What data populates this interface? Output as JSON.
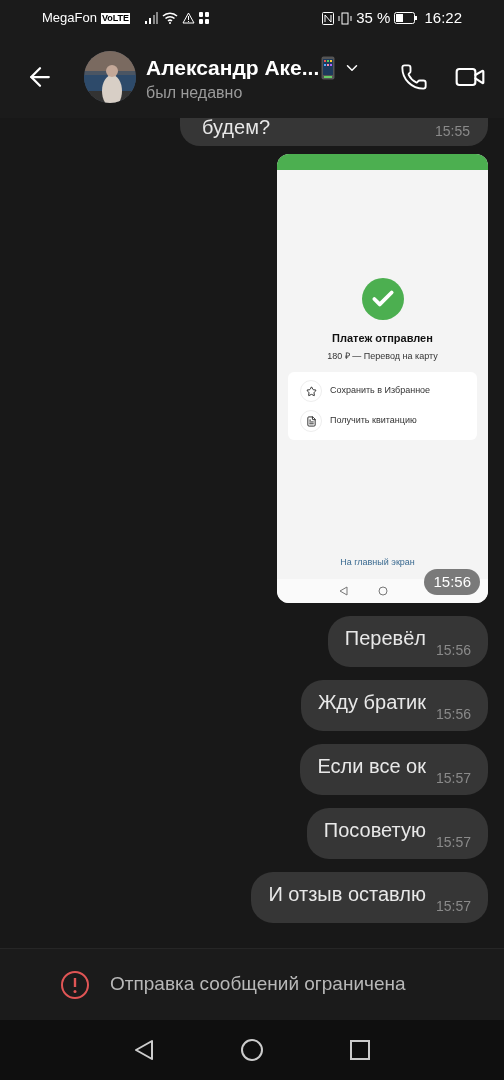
{
  "status_bar": {
    "carrier": "MegaFon",
    "volte": "VoLTE",
    "battery_text": "35 %",
    "time": "16:22"
  },
  "header": {
    "name": "Александр Аке...",
    "status": "был недавно"
  },
  "messages": [
    {
      "kind": "cut_text",
      "text": "будем?",
      "time": "15:55"
    },
    {
      "kind": "image",
      "time": "15:56",
      "screenshot": {
        "title": "Платеж отправлен",
        "subtitle": "180 ₽ — Перевод на карту",
        "actions": [
          "Сохранить в Избранное",
          "Получить квитанцию"
        ],
        "link": "На главный экран"
      }
    },
    {
      "kind": "text",
      "text": "Перевёл",
      "time": "15:56"
    },
    {
      "kind": "text",
      "text": "Жду братик",
      "time": "15:56"
    },
    {
      "kind": "text",
      "text": "Если все ок",
      "time": "15:57"
    },
    {
      "kind": "text",
      "text": "Посоветую",
      "time": "15:57"
    },
    {
      "kind": "text",
      "text": "И отзыв оставлю",
      "time": "15:57"
    }
  ],
  "restriction_notice": "Отправка сообщений ограничена"
}
